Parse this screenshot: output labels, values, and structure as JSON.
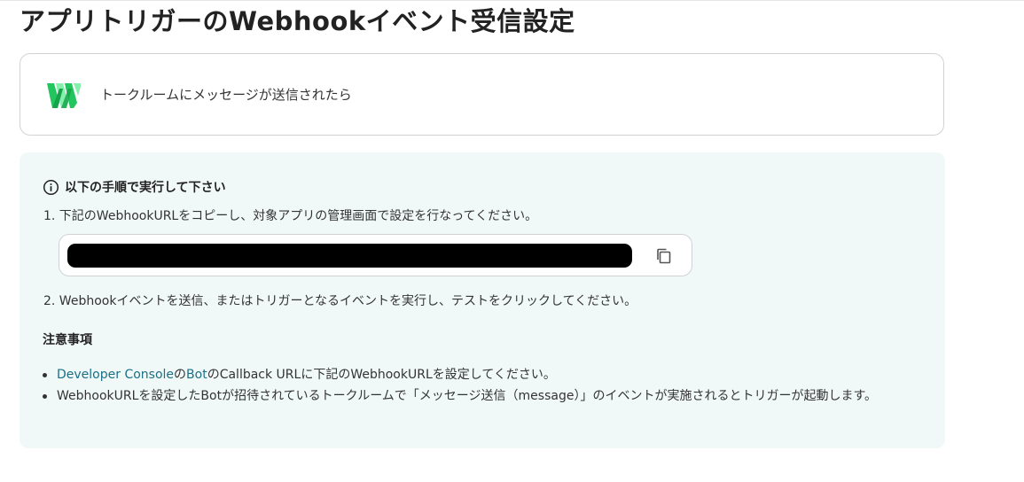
{
  "page": {
    "title": "アプリトリガーのWebhookイベント受信設定"
  },
  "trigger": {
    "app_icon": "webhook-w-logo",
    "label": "トークルームにメッセージが送信されたら"
  },
  "instructions": {
    "info_icon": "info-circle-icon",
    "heading": "以下の手順で実行して下さい",
    "step1": "1. 下記のWebhookURLをコピーし、対象アプリの管理画面で設定を行なってください。",
    "copy_icon": "copy-icon",
    "step2": "2. Webhookイベントを送信、またはトリガーとなるイベントを実行し、テストをクリックしてください。"
  },
  "notes": {
    "heading": "注意事項",
    "item1_link1": "Developer Console",
    "item1_text1": "の",
    "item1_link2": "Bot",
    "item1_text2": "のCallback URLに下記のWebhookURLを設定してください。",
    "item2": "WebhookURLを設定したBotが招待されているトークルームで「メッセージ送信（message）」のイベントが実施されるとトリガーが起動します。"
  },
  "colors": {
    "panel_bg": "#f1f9f8",
    "link": "#1b6f86",
    "logo_dark": "#1fbf5f",
    "logo_light": "#7fe0a0"
  }
}
